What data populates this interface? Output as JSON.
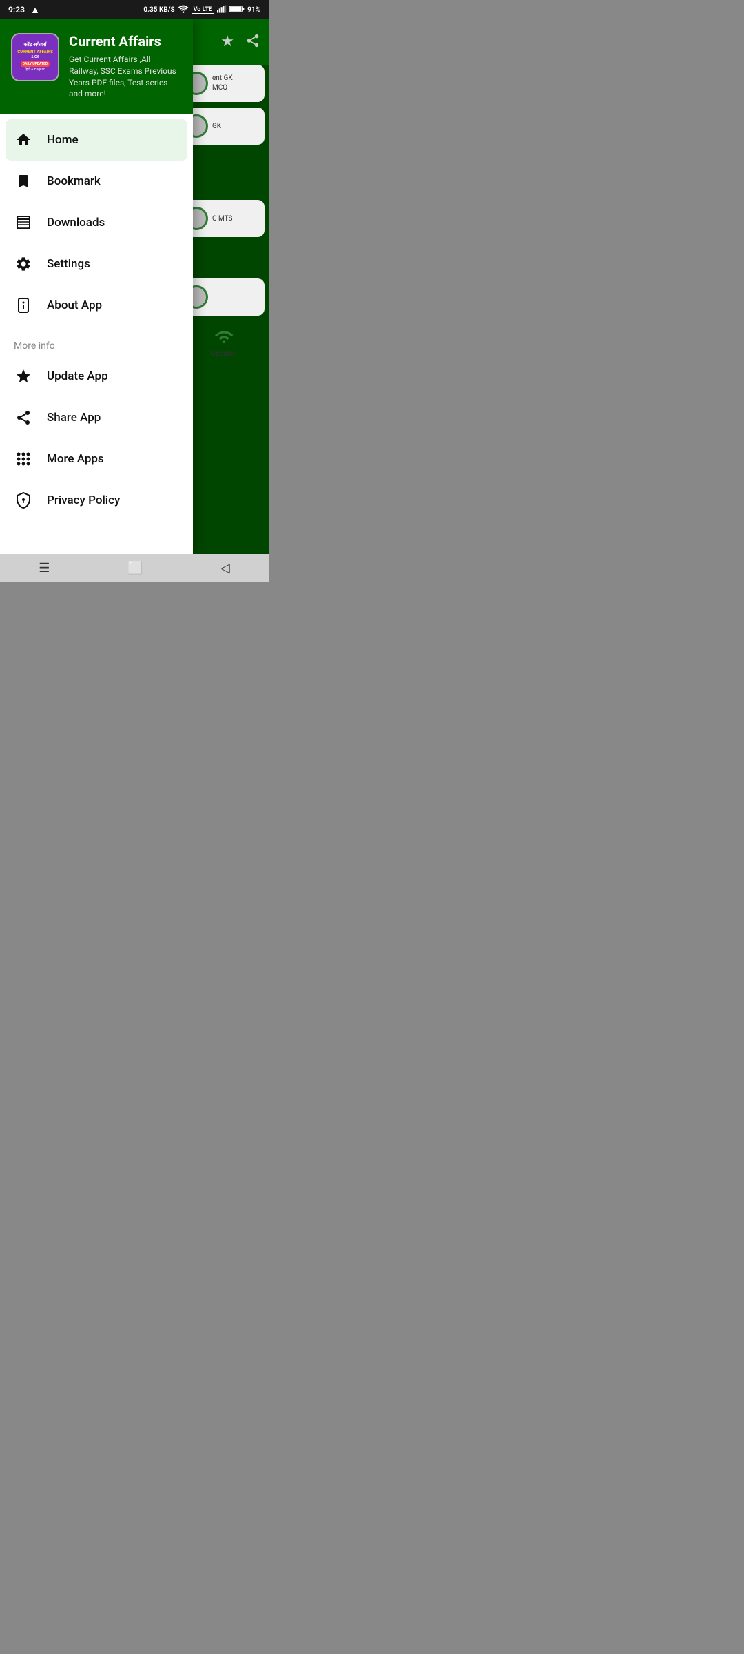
{
  "statusBar": {
    "time": "9:23",
    "navigation": "A",
    "speed": "0.35 KB/S",
    "wifi": "wifi",
    "voLte": "Vo LTE",
    "signal": "signal",
    "battery": "91%"
  },
  "appHeader": {
    "title": "Current Affairs",
    "description": "Get Current Affairs ,All Railway, SSC Exams Previous Years PDF files, Test series and more!",
    "logoHindi": "करेंट अफेयर्स",
    "logoSubtitle": "CURRENT AFFAIRS & GK",
    "logoBadge": "DAILY UPDATED",
    "logoLang": "हिंदी & English"
  },
  "menu": {
    "items": [
      {
        "id": "home",
        "label": "Home",
        "icon": "home",
        "active": true
      },
      {
        "id": "bookmark",
        "label": "Bookmark",
        "icon": "bookmark",
        "active": false
      },
      {
        "id": "downloads",
        "label": "Downloads",
        "icon": "downloads",
        "active": false
      },
      {
        "id": "settings",
        "label": "Settings",
        "icon": "settings",
        "active": false
      },
      {
        "id": "about",
        "label": "About App",
        "icon": "info",
        "active": false
      }
    ]
  },
  "moreInfo": {
    "sectionLabel": "More info",
    "items": [
      {
        "id": "update",
        "label": "Update App",
        "icon": "star"
      },
      {
        "id": "share",
        "label": "Share App",
        "icon": "share"
      },
      {
        "id": "more-apps",
        "label": "More Apps",
        "icon": "apps"
      },
      {
        "id": "privacy",
        "label": "Privacy Policy",
        "icon": "shield"
      }
    ]
  },
  "rightPeek": {
    "items": [
      {
        "topText": "ent GK",
        "bottomText": "MCQ"
      },
      {
        "topText": "GK"
      },
      {
        "topText": "C MTS"
      }
    ]
  },
  "bottomNav": {
    "menuIcon": "☰",
    "homeIcon": "⬜",
    "backIcon": "◁"
  }
}
